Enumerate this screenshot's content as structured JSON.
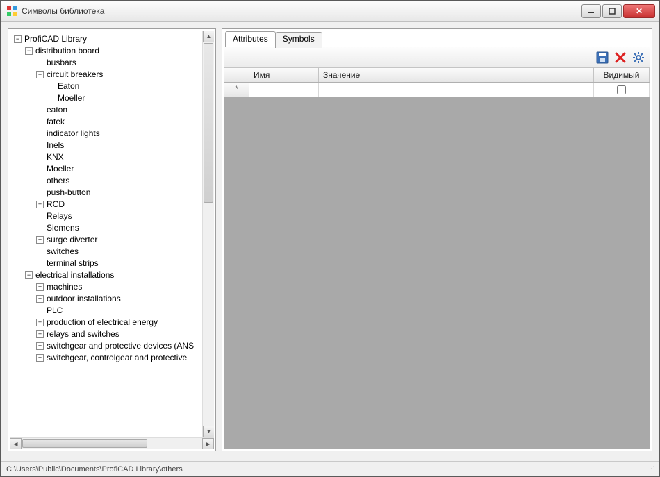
{
  "window": {
    "title": "Символы библиотека"
  },
  "tree": {
    "root": "ProfiCAD Library",
    "distribution_board": "distribution board",
    "busbars": "busbars",
    "circuit_breakers": "circuit breakers",
    "eaton_cb": "Eaton",
    "moeller_cb": "Moeller",
    "eaton": "eaton",
    "fatek": "fatek",
    "indicator_lights": "indicator lights",
    "inels": "Inels",
    "knx": "KNX",
    "moeller": "Moeller",
    "others": "others",
    "push_button": "push-button",
    "rcd": "RCD",
    "relays": "Relays",
    "siemens": "Siemens",
    "surge_diverter": "surge diverter",
    "switches": "switches",
    "terminal_strips": "terminal strips",
    "electrical_installations": "electrical installations",
    "machines": "machines",
    "outdoor_installations": "outdoor installations",
    "plc": "PLC",
    "prod_energy": "production of electrical energy",
    "relays_switches": "relays and switches",
    "switchgear_ans": "switchgear and protective devices (ANS",
    "switchgear_ctrl": "switchgear, controlgear and protective"
  },
  "tabs": {
    "attributes": "Attributes",
    "symbols": "Symbols"
  },
  "grid": {
    "col_name": "Имя",
    "col_value": "Значение",
    "col_visible": "Видимый",
    "new_row_marker": "*"
  },
  "status": {
    "path": "C:\\Users\\Public\\Documents\\ProfiCAD Library\\others"
  }
}
